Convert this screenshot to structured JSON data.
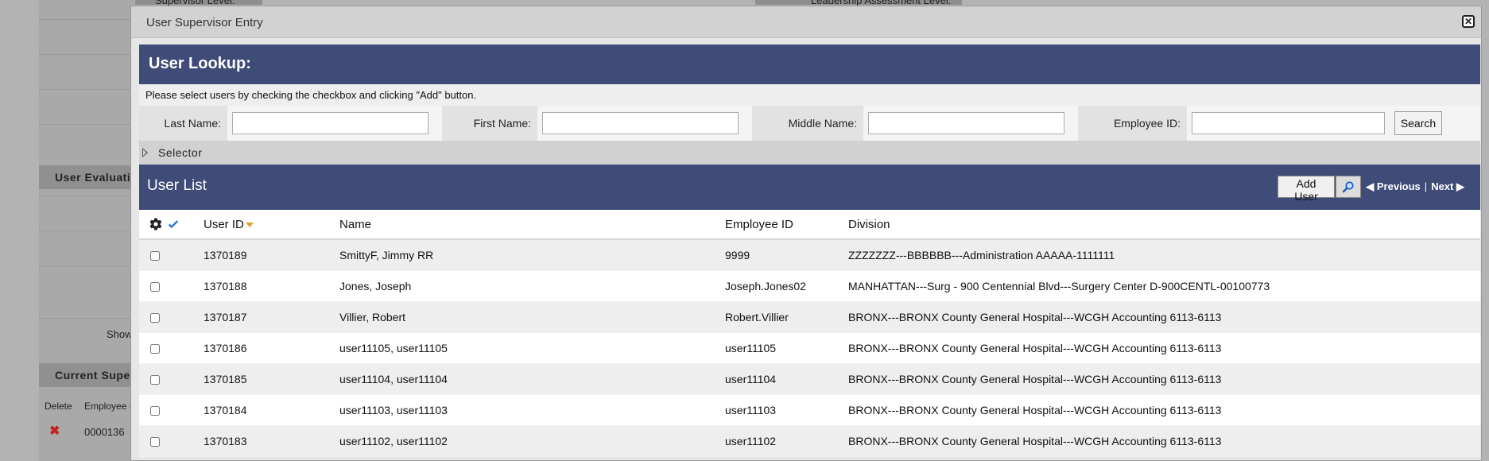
{
  "background": {
    "top_left_label": "Supervisor Level:",
    "top_right_label": "Leadership Assessment Level:",
    "section1_title": "User Evaluati",
    "show_label": "Show",
    "section2_title": "Current Supe",
    "col_delete": "Delete",
    "col_employee": "Employee I",
    "employee_value": "0000136"
  },
  "dialog": {
    "title": "User Supervisor Entry",
    "close_glyph": "✕"
  },
  "lookup": {
    "heading": "User Lookup:",
    "instructions": "Please select users by checking the checkbox and clicking \"Add\" button.",
    "fields": {
      "last_name_label": "Last Name:",
      "last_name_value": "",
      "first_name_label": "First Name:",
      "first_name_value": "",
      "middle_name_label": "Middle Name:",
      "middle_name_value": "",
      "employee_id_label": "Employee ID:",
      "employee_id_value": ""
    },
    "search_label": "Search",
    "selector_label": "Selector"
  },
  "user_list": {
    "heading": "User List",
    "add_user_label": "Add User",
    "previous_label": "Previous",
    "separator": "|",
    "next_label": "Next",
    "columns": {
      "user_id": "User ID",
      "name": "Name",
      "employee_id": "Employee ID",
      "division": "Division"
    },
    "rows": [
      {
        "user_id": "1370189",
        "name": "SmittyF, Jimmy RR",
        "employee_id": "9999",
        "division": "ZZZZZZZ---BBBBBB---Administration AAAAA-1111111"
      },
      {
        "user_id": "1370188",
        "name": "Jones, Joseph",
        "employee_id": "Joseph.Jones02",
        "division": "MANHATTAN---Surg - 900 Centennial Blvd---Surgery Center D-900CENTL-00100773"
      },
      {
        "user_id": "1370187",
        "name": "Villier, Robert",
        "employee_id": "Robert.Villier",
        "division": "BRONX---BRONX County General Hospital---WCGH Accounting 6113-6113"
      },
      {
        "user_id": "1370186",
        "name": "user11105, user11105",
        "employee_id": "user11105",
        "division": "BRONX---BRONX County General Hospital---WCGH Accounting 6113-6113"
      },
      {
        "user_id": "1370185",
        "name": "user11104, user11104",
        "employee_id": "user11104",
        "division": "BRONX---BRONX County General Hospital---WCGH Accounting 6113-6113"
      },
      {
        "user_id": "1370184",
        "name": "user11103, user11103",
        "employee_id": "user11103",
        "division": "BRONX---BRONX County General Hospital---WCGH Accounting 6113-6113"
      },
      {
        "user_id": "1370183",
        "name": "user11102, user11102",
        "employee_id": "user11102",
        "division": "BRONX---BRONX County General Hospital---WCGH Accounting 6113-6113"
      }
    ]
  },
  "icons": {
    "gear": "gear-icon",
    "check": "check-icon",
    "sort": "sort-desc-icon",
    "magnifier": "magnifier-icon",
    "prev": "triangle-left-icon",
    "next": "triangle-right-icon",
    "expand": "triangle-right-icon",
    "delete": "red-x-icon"
  },
  "colors": {
    "band": "#3f4c77",
    "sort_arrow": "#e59c2c",
    "check": "#1e6fd9",
    "delete": "#c0221e"
  }
}
